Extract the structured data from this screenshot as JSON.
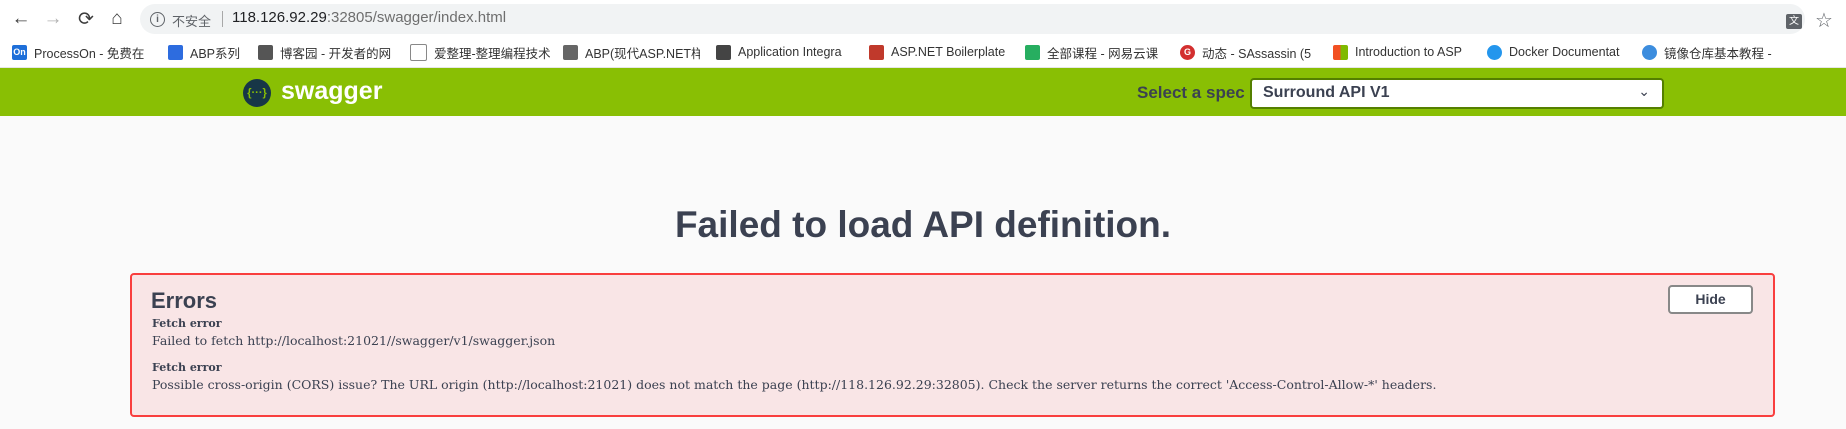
{
  "browser": {
    "back_icon": "←",
    "forward_icon": "→",
    "reload_icon": "⟳",
    "home_icon": "⌂",
    "security_label": "不安全",
    "url_host": "118.126.92.29",
    "url_rest": ":32805/swagger/index.html",
    "translate_icon": "文",
    "star_icon": "☆"
  },
  "bookmarks": [
    {
      "label": "ProcessOn - 免费在",
      "icon_text": "On",
      "color": "#1e6fd9"
    },
    {
      "label": "ABP系列",
      "icon_text": "",
      "color": "#2d6cdf"
    },
    {
      "label": "博客园 - 开发者的网",
      "icon_text": "",
      "color": "#555555"
    },
    {
      "label": "爱整理-整理编程技术",
      "icon_text": "",
      "color": "#888888"
    },
    {
      "label": "ABP(现代ASP.NET样",
      "icon_text": "",
      "color": "#666666"
    },
    {
      "label": "Application Integra",
      "icon_text": "",
      "color": "#444444"
    },
    {
      "label": "ASP.NET Boilerplate",
      "icon_text": "",
      "color": "#c0392b"
    },
    {
      "label": "全部课程 - 网易云课",
      "icon_text": "",
      "color": "#27ae60"
    },
    {
      "label": "动态 - SAssassin (5",
      "icon_text": "G",
      "color": "#d32f2f"
    },
    {
      "label": "Introduction to ASP",
      "icon_text": "",
      "color": "#f25022"
    },
    {
      "label": "Docker Documentat",
      "icon_text": "",
      "color": "#2496ed"
    },
    {
      "label": "镜像仓库基本教程 -",
      "icon_text": "",
      "color": "#3c8dde"
    }
  ],
  "swagger": {
    "logo_icon": "{···}",
    "logo_text": "swagger",
    "spec_label": "Select a spec",
    "spec_value": "Surround API V1",
    "chevron": "⌄"
  },
  "main": {
    "title": "Failed to load API definition.",
    "errors_title": "Errors",
    "hide_label": "Hide",
    "errors": [
      {
        "heading": "Fetch error",
        "message": "Failed to fetch http://localhost:21021//swagger/v1/swagger.json"
      },
      {
        "heading": "Fetch error",
        "message": "Possible cross-origin (CORS) issue? The URL origin (http://localhost:21021) does not match the page (http://118.126.92.29:32805). Check the server returns the correct 'Access-Control-Allow-*' headers."
      }
    ]
  }
}
